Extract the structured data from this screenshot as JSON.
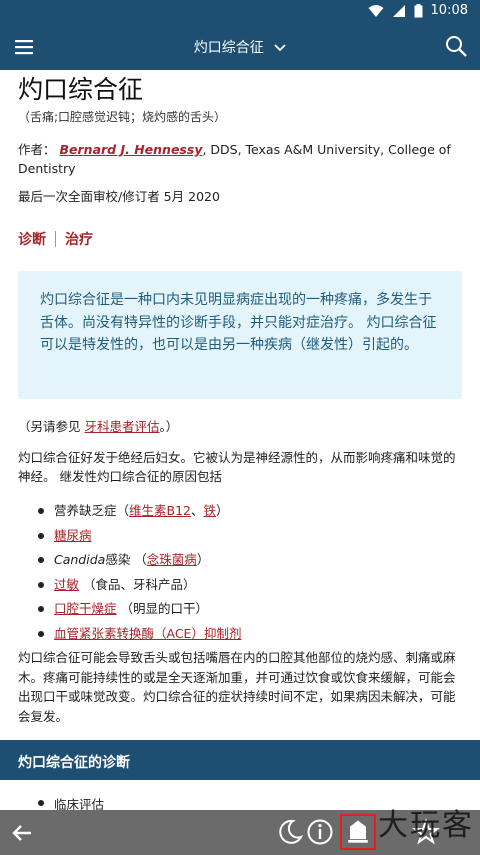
{
  "status": {
    "time": "10:08"
  },
  "appbar": {
    "title": "灼口综合征"
  },
  "page": {
    "title": "灼口综合征",
    "synonyms": "（舌痛;口腔感觉迟钝；烧灼感的舌头）",
    "author_prefix": "作者：",
    "author_name": "Bernard J. Hennessy",
    "author_suffix": ", DDS, Texas A&M University, College of Dentistry",
    "review": "最后一次全面审校/修订者 5月 2020"
  },
  "tabs": [
    {
      "label": "诊断"
    },
    {
      "label": "治疗"
    }
  ],
  "summary": "灼口综合征是一种口内未见明显病症出现的一种疼痛，多发生于舌体。尚没有特异性的诊断手段，并只能对症治疗。 灼口综合征可以是特发性的，也可以是由另一种疾病（继发性）引起的。",
  "also": {
    "prefix": "（另请参见 ",
    "link": "牙科患者评估",
    "suffix": "。）"
  },
  "para1": "灼口综合征好发于绝经后妇女。它被认为是神经源性的，从而影响疼痛和味觉的神经。 继发性灼口综合征的原因包括",
  "causes": {
    "c1_text": "营养缺乏症（",
    "c1_link1": "维生素B12",
    "c1_sep": "、",
    "c1_link2": "铁",
    "c1_end": "）",
    "c2_link": "糖尿病",
    "c3_ital": "Candida",
    "c3_text": "感染 （",
    "c3_link": "念珠菌病",
    "c3_end": "）",
    "c4_link": "过敏",
    "c4_text": " （食品、牙科产品）",
    "c5_link": "口腔干燥症",
    "c5_text": " （明显的口干）",
    "c6_link": "血管紧张素转换酶（ACE）抑制剂"
  },
  "para2": "灼口综合征可能会导致舌头或包括嘴唇在内的口腔其他部位的烧灼感、刺痛或麻木。疼痛可能持续性的或是全天逐渐加重，并可通过饮食或饮食来缓解，可能会出现口干或味觉改变。灼口综合征的症状持续时间不定，如果病因未解决，可能会复发。",
  "section": {
    "title": "灼口综合征的诊断"
  },
  "diagnosis_items": [
    "临床评估"
  ],
  "watermark": "大玩客",
  "colors": {
    "primary": "#1e4f72",
    "link": "#a8232a",
    "summary_bg": "#e3f4fa",
    "bottom_bar": "#6b6b6b"
  }
}
